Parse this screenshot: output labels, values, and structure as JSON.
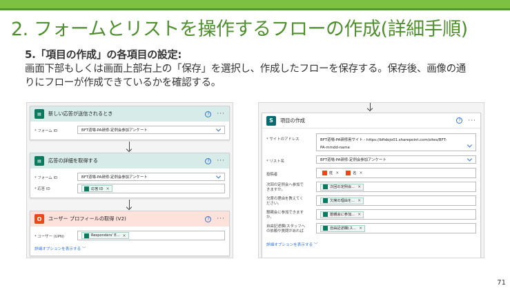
{
  "slide": {
    "title": "2. フォームとリストを操作するフローの作成(詳細手順)",
    "sub_heading": "5.「項目の作成」の各項目の設定:",
    "body": "画面下部もしくは画面上部右上の「保存」を選択し、作成したフローを保存する。保存後、画像の通りにフローが作成できているかを確認する。",
    "page_number": "71"
  },
  "left_flow": {
    "card1": {
      "title": "新しい応答が送信されるとき",
      "form_label": "* フォーム ID",
      "form_value": "BFT道場-PA研修-定例会参加アンケート"
    },
    "card2": {
      "title": "応答の詳細を取得する",
      "form_label": "* フォーム ID",
      "form_value": "BFT道場-PA研修-定例会参加アンケート",
      "response_label": "* 応答 ID",
      "response_token": "応答 ID"
    },
    "card3": {
      "title": "ユーザー プロフィールの取得 (V2)",
      "user_label": "* ユーザー (UPN)",
      "user_token": "Responders' E..."
    },
    "advanced_link": "詳細オプションを表示する"
  },
  "right_flow": {
    "title": "項目の作成",
    "site_label": "* サイトのアドレス",
    "site_value_line1": "BFT道場-PA研修用サイト - https://bftdojo01.sharepoint.com/sites/BFT-",
    "site_value_line2": "PA-mmdd-name",
    "list_label": "* リスト名",
    "list_value": "BFT道場-PA研修-定例会参加アンケート",
    "rows": [
      {
        "label_line1": "投稿者",
        "label_line2": "",
        "tokens": [
          "姓",
          "名"
        ]
      },
      {
        "label_line1": "次回の定例会へ参加で",
        "label_line2": "きますか。",
        "tokens": [
          "次回の定例会..."
        ]
      },
      {
        "label_line1": "欠席の理由を教えてく",
        "label_line2": "ださい。",
        "tokens": [
          "欠席の理由を..."
        ]
      },
      {
        "label_line1": "懇親会に参加できます",
        "label_line2": "か。",
        "tokens": [
          "懇親会に参加..."
        ]
      },
      {
        "label_line1": "自由記述欄(スタッフへ",
        "label_line2": "の依頼や質問があれば",
        "tokens": [
          "自由記述欄(ス..."
        ]
      }
    ],
    "advanced_link": "詳細オプションを表示する"
  },
  "colors": {
    "accent_green": "#7dc142",
    "title_green": "#4f8f2e",
    "forms_icon": "#0b7a5e",
    "office_icon": "#e64a19",
    "sharepoint_icon": "#036c70",
    "link_blue": "#2f6fd6"
  }
}
